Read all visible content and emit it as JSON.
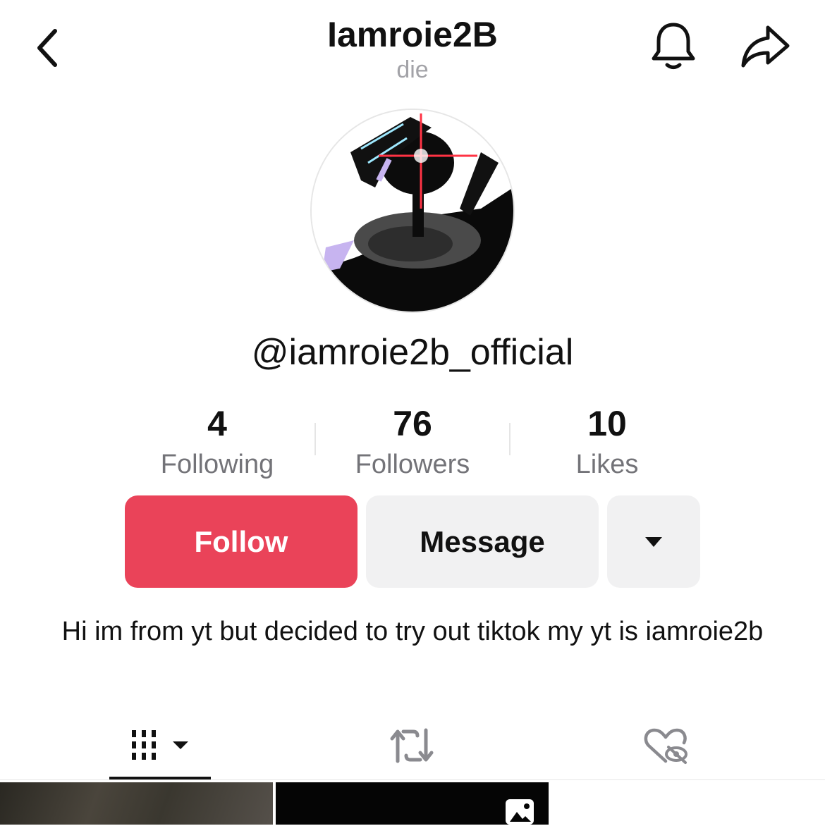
{
  "header": {
    "title": "Iamroie2B",
    "subtitle": "die",
    "back_icon": "chevron-left-icon",
    "bell_icon": "bell-icon",
    "share_icon": "share-arrow-icon"
  },
  "profile": {
    "handle": "@iamroie2b_official",
    "bio": "Hi im from yt but decided to try out tiktok my yt is iamroie2b"
  },
  "stats": [
    {
      "value": "4",
      "label": "Following"
    },
    {
      "value": "76",
      "label": "Followers"
    },
    {
      "value": "10",
      "label": "Likes"
    }
  ],
  "actions": {
    "follow_label": "Follow",
    "message_label": "Message",
    "more_icon": "caret-down-icon"
  },
  "tabs": {
    "videos_icon": "grid-icon",
    "reposts_icon": "repost-icon",
    "liked_icon": "hidden-heart-icon"
  },
  "colors": {
    "accent": "#ea4359",
    "secondary_button": "#f1f1f2",
    "muted_text": "#737378"
  }
}
